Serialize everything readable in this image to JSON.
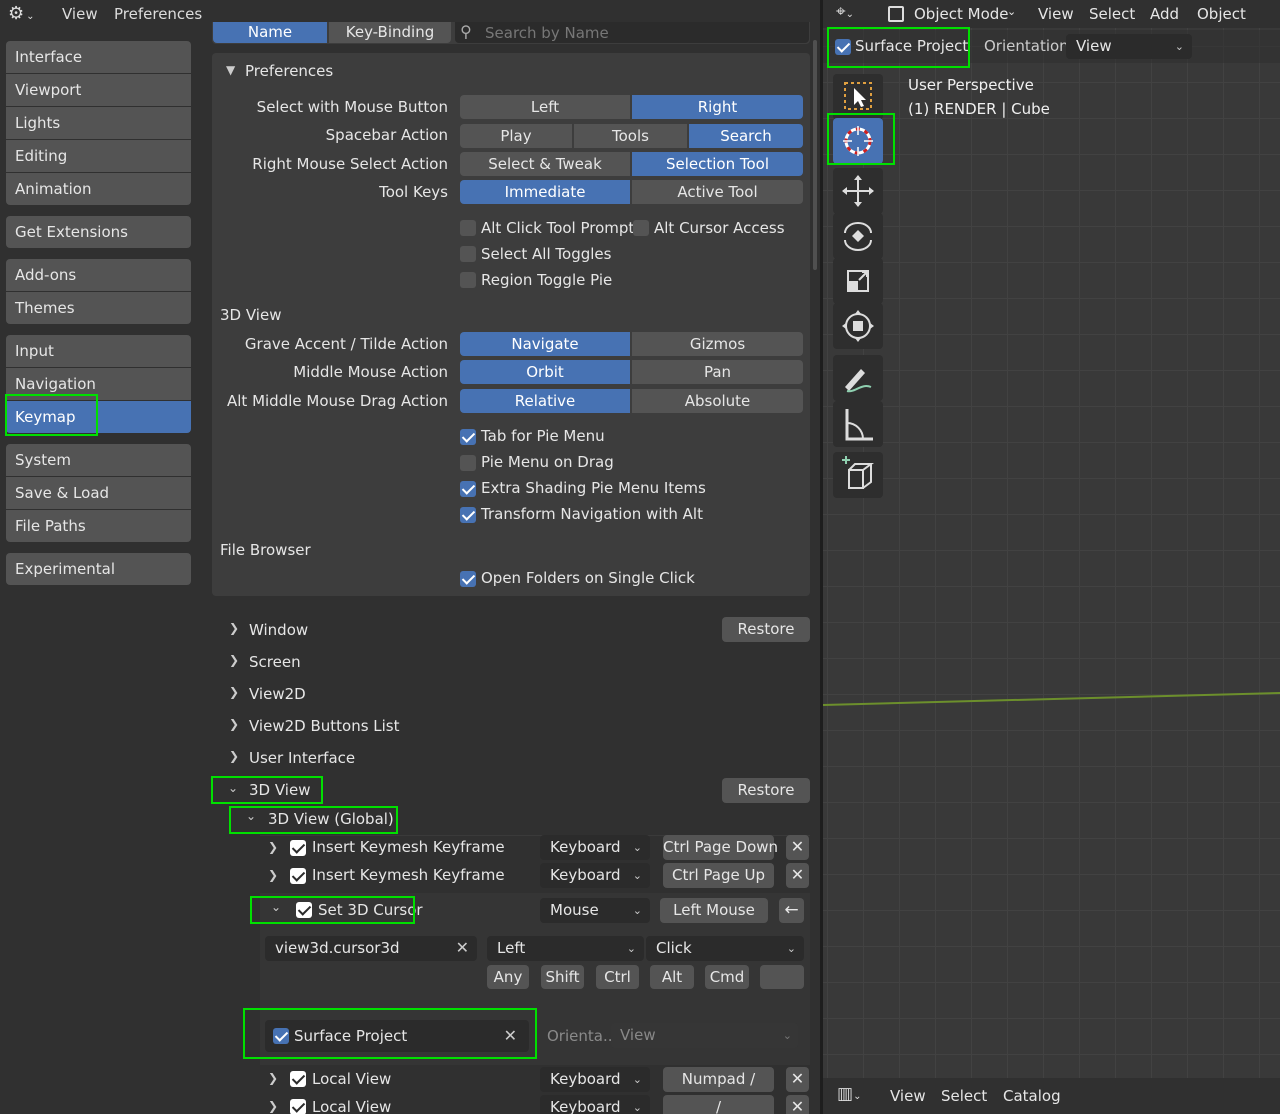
{
  "prefs_header": {
    "menu": [
      "View",
      "Preferences"
    ]
  },
  "sidebar": {
    "groups": [
      [
        "Interface",
        "Viewport",
        "Lights",
        "Editing",
        "Animation"
      ],
      [
        "Get Extensions"
      ],
      [
        "Add-ons",
        "Themes"
      ],
      [
        "Input",
        "Navigation",
        "Keymap"
      ],
      [
        "System",
        "Save & Load",
        "File Paths"
      ],
      [
        "Experimental"
      ]
    ],
    "active": "Keymap"
  },
  "search_row": {
    "tab_name": "Name",
    "tab_key": "Key-Binding",
    "search_placeholder": "Search by Name"
  },
  "preferences": {
    "title": "Preferences",
    "select_mouse": {
      "label": "Select with Mouse Button",
      "options": [
        "Left",
        "Right"
      ],
      "selected": "Right"
    },
    "spacebar": {
      "label": "Spacebar Action",
      "options": [
        "Play",
        "Tools",
        "Search"
      ],
      "selected": "Search"
    },
    "right_mouse": {
      "label": "Right Mouse Select Action",
      "options": [
        "Select & Tweak",
        "Selection Tool"
      ],
      "selected": "Selection Tool"
    },
    "tool_keys": {
      "label": "Tool Keys",
      "options": [
        "Immediate",
        "Active Tool"
      ],
      "selected": "Immediate"
    },
    "checks1": [
      {
        "label": "Alt Click Tool Prompt",
        "checked": false
      },
      {
        "label": "Alt Cursor Access",
        "checked": false
      },
      {
        "label": "Select All Toggles",
        "checked": false
      },
      {
        "label": "Region Toggle Pie",
        "checked": false
      }
    ],
    "view3d_title": "3D View",
    "grave": {
      "label": "Grave Accent / Tilde Action",
      "options": [
        "Navigate",
        "Gizmos"
      ],
      "selected": "Navigate"
    },
    "middle": {
      "label": "Middle Mouse Action",
      "options": [
        "Orbit",
        "Pan"
      ],
      "selected": "Orbit"
    },
    "alt_middle": {
      "label": "Alt Middle Mouse Drag Action",
      "options": [
        "Relative",
        "Absolute"
      ],
      "selected": "Relative"
    },
    "checks2": [
      {
        "label": "Tab for Pie Menu",
        "checked": true
      },
      {
        "label": "Pie Menu on Drag",
        "checked": false
      },
      {
        "label": "Extra Shading Pie Menu Items",
        "checked": true
      },
      {
        "label": "Transform Navigation with Alt",
        "checked": true
      }
    ],
    "file_browser_title": "File Browser",
    "open_folders": {
      "label": "Open Folders on Single Click",
      "checked": true
    }
  },
  "keymap_tree": {
    "restore_label": "Restore",
    "collapsed": [
      "Window",
      "Screen",
      "View2D",
      "View2D Buttons List",
      "User Interface"
    ],
    "view3d": "3D View",
    "view3d_global": "3D View (Global)",
    "items": [
      {
        "name": "Insert Keymesh Keyframe",
        "type": "Keyboard",
        "key": "Ctrl Page Down"
      },
      {
        "name": "Insert Keymesh Keyframe",
        "type": "Keyboard",
        "key": "Ctrl Page Up"
      }
    ],
    "expanded_item": {
      "name": "Set 3D Cursor",
      "type": "Mouse",
      "key": "Left Mouse",
      "operator": "view3d.cursor3d",
      "button": "Left",
      "event": "Click",
      "modifiers": [
        "Any",
        "Shift",
        "Ctrl",
        "Alt",
        "Cmd"
      ],
      "surface_project": "Surface Project",
      "orientation_label": "Orienta...",
      "orientation_value": "View"
    },
    "items_after": [
      {
        "name": "Local View",
        "type": "Keyboard",
        "key": "Numpad /"
      },
      {
        "name": "Local View",
        "type": "Keyboard",
        "key": "/"
      }
    ]
  },
  "viewport": {
    "mode": "Object Mode",
    "menu": [
      "View",
      "Select",
      "Add",
      "Object"
    ],
    "surface_project": "Surface Project",
    "orientation_label": "Orientation:",
    "orientation_value": "View",
    "info_line1": "User Perspective",
    "info_line2": "(1) RENDER | Cube",
    "tools": [
      "select-box-icon",
      "cursor-icon",
      "move-icon",
      "rotate-icon",
      "scale-icon",
      "transform-icon",
      "annotate-icon",
      "measure-icon",
      "add-cube-icon"
    ],
    "bottom_menu": [
      "View",
      "Select",
      "Catalog"
    ]
  },
  "colors": {
    "accent": "#4772b3",
    "highlight": "#00e000",
    "panel": "#3d3d3d",
    "button": "#545454"
  }
}
